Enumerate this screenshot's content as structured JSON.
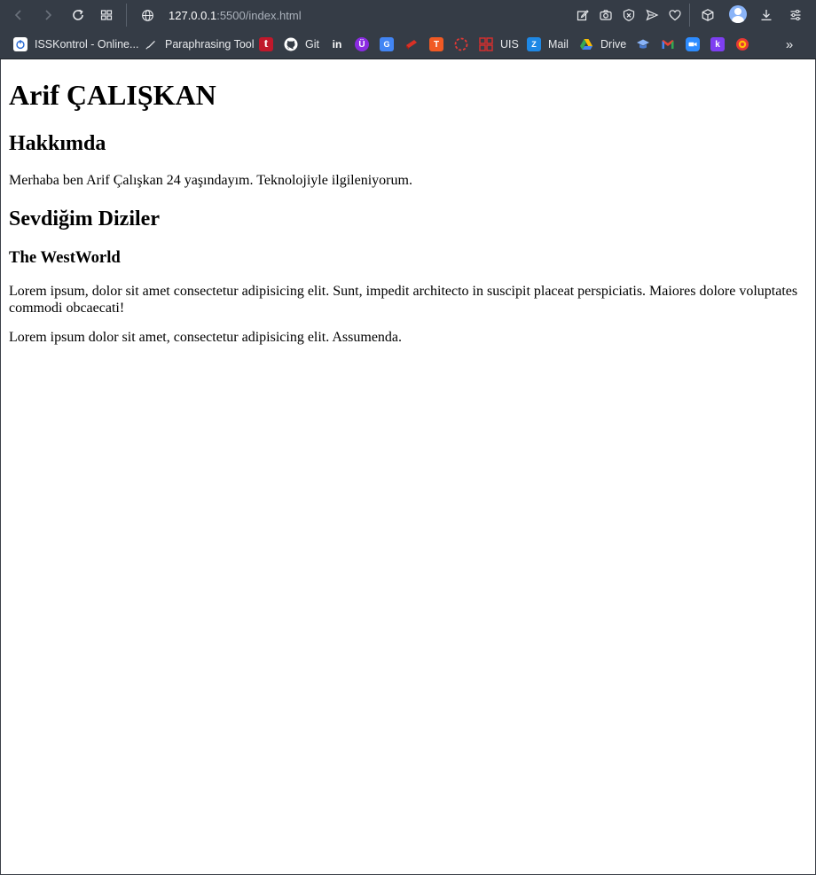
{
  "browser": {
    "url_host": "127.0.0.1",
    "url_path": ":5500/index.html",
    "toolbar_icons": [
      "back-icon",
      "forward-icon",
      "reload-icon",
      "tabs-grid-icon",
      "globe-icon",
      "edit-icon",
      "camera-icon",
      "shield-x-icon",
      "send-icon",
      "heart-icon",
      "cube-icon",
      "profile-avatar",
      "download-icon",
      "settings-icon"
    ],
    "colors": {
      "chrome": "#353c46",
      "text": "#e8eaed",
      "muted": "#aab1bb"
    }
  },
  "bookmarks": {
    "items": [
      {
        "label": "ISSKontrol - Online...",
        "icon": "isskontrol-icon",
        "color": "#ffffff"
      },
      {
        "label": "Paraphrasing Tool",
        "icon": "feather-icon",
        "color": "#e8eaed"
      },
      {
        "label": "",
        "icon": "t-icon",
        "color": "#c0182b"
      },
      {
        "label": "Git",
        "icon": "github-icon",
        "color": "#ffffff"
      },
      {
        "label": "",
        "icon": "linkedin-icon",
        "color": "#0a66c2"
      },
      {
        "label": "",
        "icon": "u-icon",
        "color": "#8a2be2"
      },
      {
        "label": "",
        "icon": "translate-icon",
        "color": "#4285f4"
      },
      {
        "label": "",
        "icon": "book-icon",
        "color": "#d93025"
      },
      {
        "label": "",
        "icon": "t-square-icon",
        "color": "#f15a24"
      },
      {
        "label": "",
        "icon": "circle-dash-icon",
        "color": "#e53935"
      },
      {
        "label": "UIS",
        "icon": "uis-icon",
        "color": "#d32f2f"
      },
      {
        "label": "Mail",
        "icon": "zoho-mail-icon",
        "color": "#1e88e5"
      },
      {
        "label": "Drive",
        "icon": "drive-icon",
        "color": "#34a853"
      },
      {
        "label": "",
        "icon": "mortarboard-icon",
        "color": "#4a7bd0"
      },
      {
        "label": "",
        "icon": "gmail-icon",
        "color": "#ea4335"
      },
      {
        "label": "",
        "icon": "zoom-icon",
        "color": "#2d8cff"
      },
      {
        "label": "",
        "icon": "k-icon",
        "color": "#7e3ff2"
      },
      {
        "label": "",
        "icon": "target-icon",
        "color": "#e53935"
      }
    ],
    "more": "»"
  },
  "page": {
    "title": "Arif ÇALIŞKAN",
    "about_heading": "Hakkımda",
    "about_text": "Merhaba ben Arif Çalışkan 24 yaşındayım. Teknolojiyle ilgileniyorum.",
    "series_heading": "Sevdiğim Diziler",
    "show_title": "The WestWorld",
    "paragraph_1": "Lorem ipsum, dolor sit amet consectetur adipisicing elit. Sunt, impedit architecto in suscipit placeat perspiciatis. Maiores dolore voluptates commodi obcaecati!",
    "paragraph_2": "Lorem ipsum dolor sit amet, consectetur adipisicing elit. Assumenda."
  }
}
